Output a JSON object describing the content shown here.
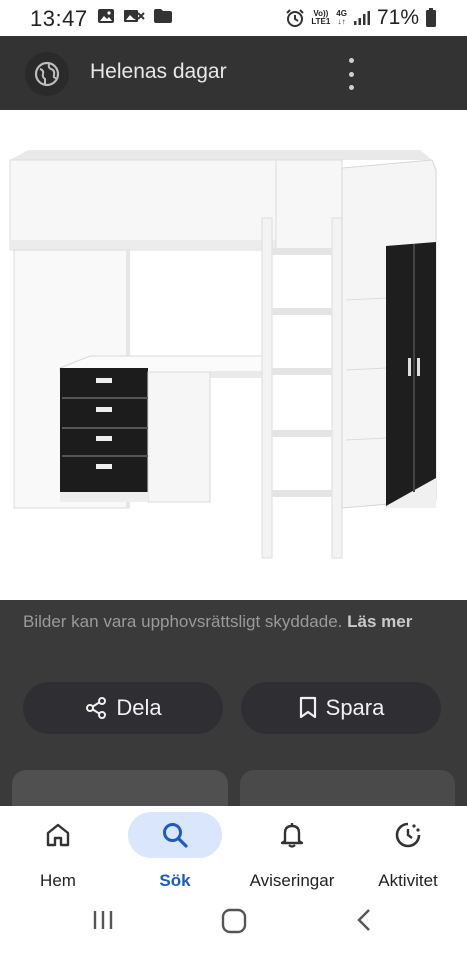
{
  "status_bar": {
    "time": "13:47",
    "battery": "71%",
    "net_top": "Vo))",
    "net_bottom": "LTE1",
    "net_gen": "4G"
  },
  "app_bar": {
    "title": "Helenas dagar"
  },
  "image": {
    "description_icon": "loft-bed-with-desk-drawers-and-wardrobe"
  },
  "copyright": {
    "text": "Bilder kan vara upphovsrättsligt skyddade.",
    "link": "Läs mer"
  },
  "actions": {
    "share_label": "Dela",
    "save_label": "Spara"
  },
  "bottom_nav": {
    "items": [
      {
        "label": "Hem",
        "icon": "home-icon"
      },
      {
        "label": "Sök",
        "icon": "search-icon",
        "active": true
      },
      {
        "label": "Aviseringar",
        "icon": "bell-icon"
      },
      {
        "label": "Aktivitet",
        "icon": "activity-icon"
      }
    ]
  },
  "colors": {
    "active_nav": "#1a5bc4",
    "active_pill": "#d9e6fb",
    "app_bar": "#333333"
  }
}
